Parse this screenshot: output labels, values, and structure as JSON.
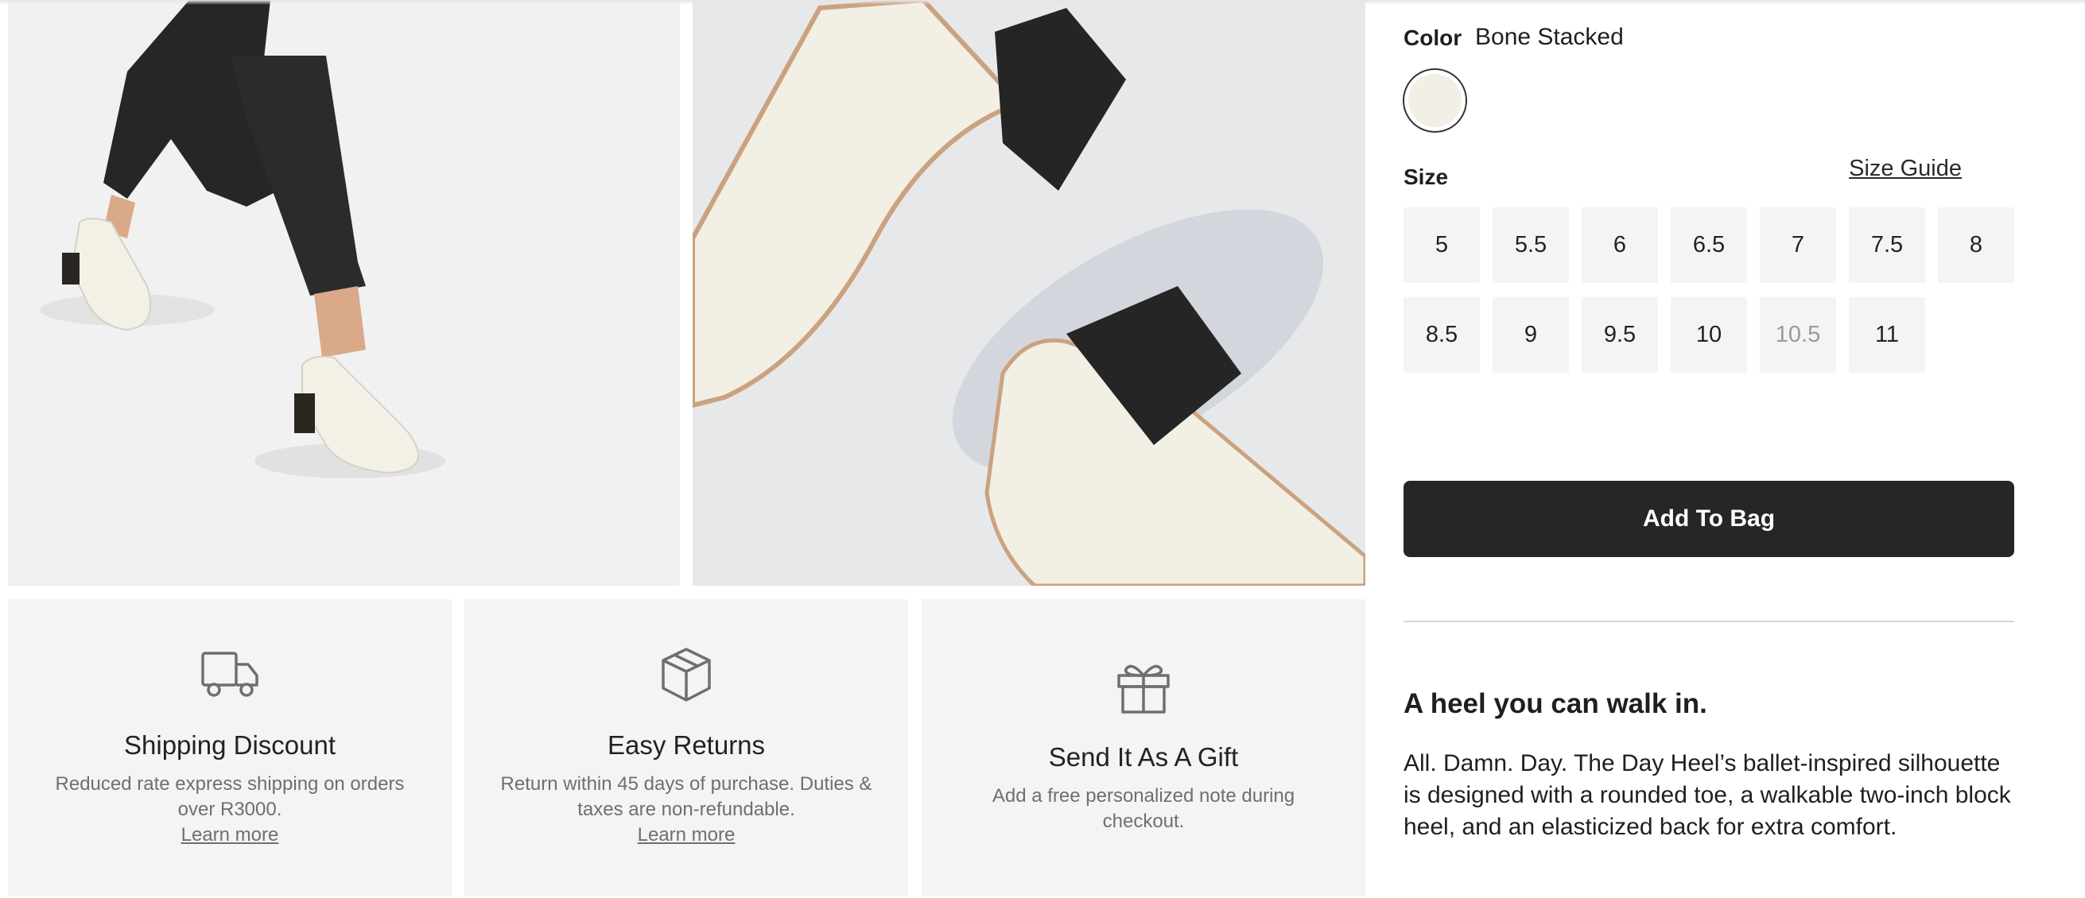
{
  "product": {
    "color_label": "Color",
    "color_value": "Bone Stacked",
    "swatch_color": "#f1efe6",
    "size_label": "Size",
    "size_guide_label": "Size Guide",
    "sizes": [
      {
        "label": "5",
        "available": true
      },
      {
        "label": "5.5",
        "available": true
      },
      {
        "label": "6",
        "available": true
      },
      {
        "label": "6.5",
        "available": true
      },
      {
        "label": "7",
        "available": true
      },
      {
        "label": "7.5",
        "available": true
      },
      {
        "label": "8",
        "available": true
      },
      {
        "label": "8.5",
        "available": true
      },
      {
        "label": "9",
        "available": true
      },
      {
        "label": "9.5",
        "available": true
      },
      {
        "label": "10",
        "available": true
      },
      {
        "label": "10.5",
        "available": false
      },
      {
        "label": "11",
        "available": true
      }
    ],
    "add_to_bag_label": "Add To Bag",
    "description_heading": "A heel you can walk in.",
    "description": "All. Damn. Day. The Day Heel’s ballet-inspired silhouette is designed with a rounded toe, a walkable two-inch block heel, and an elasticized back for extra comfort."
  },
  "features": [
    {
      "icon": "truck-icon",
      "title": "Shipping Discount",
      "text": "Reduced rate express shipping on orders over R3000.",
      "link": "Learn more"
    },
    {
      "icon": "box-icon",
      "title": "Easy Returns",
      "text": "Return within 45 days of purchase. Duties & taxes are non-refundable.",
      "link": "Learn more"
    },
    {
      "icon": "gift-icon",
      "title": "Send It As A Gift",
      "text": "Add a free personalized note during checkout."
    }
  ],
  "colors": {
    "button_bg": "#262626",
    "card_bg": "#f4f4f4",
    "muted_text": "#6f6f6f"
  }
}
